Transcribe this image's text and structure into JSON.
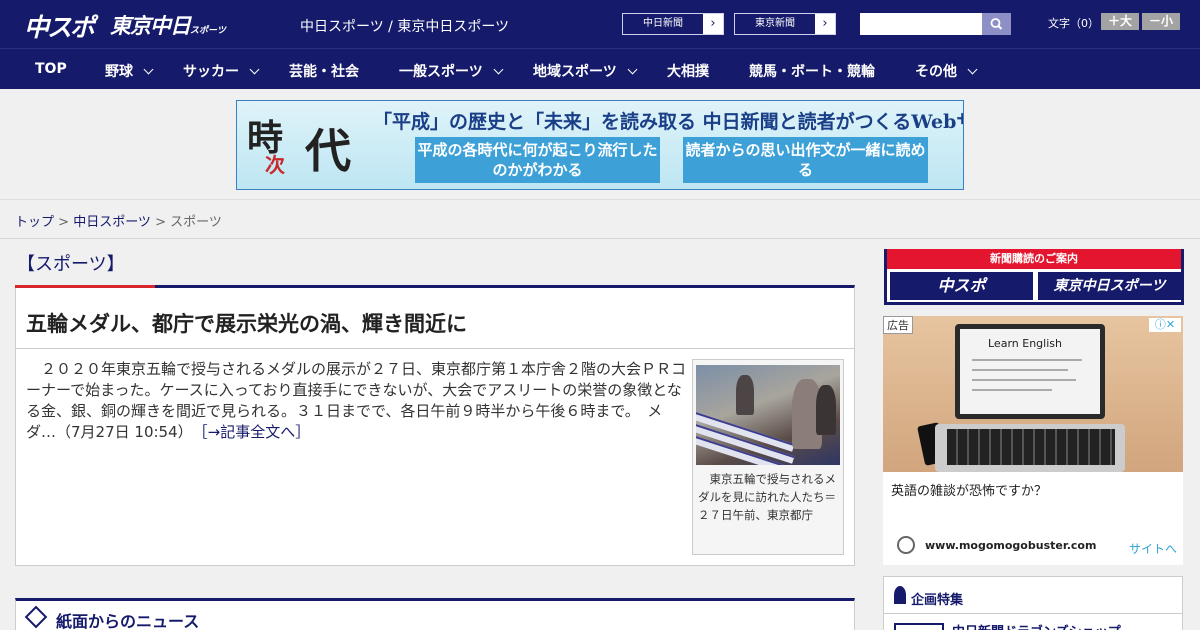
{
  "header": {
    "logo_chuspo": "中スポ",
    "logo_tokyo": "東京中日",
    "logo_tokyo_small": "スポーツ",
    "site_name": "中日スポーツ / 東京中日スポーツ",
    "ext_links": [
      "中日新聞",
      "東京新聞"
    ],
    "search_placeholder": "",
    "font_size_label": "文字（0）",
    "font_bigger": "＋大",
    "font_smaller": "－小"
  },
  "nav": {
    "items": [
      {
        "label": "TOP",
        "has_menu": false
      },
      {
        "label": "野球",
        "has_menu": true
      },
      {
        "label": "サッカー",
        "has_menu": true
      },
      {
        "label": "芸能・社会",
        "has_menu": false
      },
      {
        "label": "一般スポーツ",
        "has_menu": true
      },
      {
        "label": "地域スポーツ",
        "has_menu": true
      },
      {
        "label": "大相撲",
        "has_menu": false
      },
      {
        "label": "競馬・ボート・競輪",
        "has_menu": false
      },
      {
        "label": "その他",
        "has_menu": true
      }
    ]
  },
  "banner": {
    "ji1": "時",
    "ji2": "次",
    "dai": "代",
    "headline": "「平成」の歴史と「未来」を読み取る 中日新聞と読者がつくるWebサイト",
    "box1": "平成の各時代に何が起こり流行したのかがわかる",
    "box2": "読者からの思い出作文が一緒に読める"
  },
  "breadcrumb": {
    "home": "トップ",
    "sep": " > ",
    "parent": "中日スポーツ",
    "current": "スポーツ"
  },
  "section": {
    "title": "【スポーツ】"
  },
  "article": {
    "title": "五輪メダル、都庁で展示栄光の渦、輝き間近に",
    "body": "２０２０年東京五輪で授与されるメダルの展示が２７日、東京都庁第１本庁舎２階の大会ＰＲコーナーで始まった。ケースに入っており直接手にできないが、大会でアスリートの栄誉の象徴となる金、銀、銅の輝きを間近で見られる。３１日までで、各日午前９時半から午後６時まで。　メダ…（7月27日 10:54）",
    "more_link": "［→記事全文へ］",
    "photo_caption": "東京五輪で授与されるメダルを見に訪れた人たち＝２７日午前、東京都庁"
  },
  "news_section": {
    "title": "紙面からのニュース"
  },
  "sidebar": {
    "subscribe_head": "新聞購読のご案内",
    "subscribe_logos": [
      "中スポ",
      "東京中日スポーツ"
    ],
    "ad": {
      "label": "広告",
      "screen_title": "Learn English",
      "text": "英語の雑談が恐怖ですか？",
      "domain": "www.mogomogobuster.com",
      "site_link": "サイトへ"
    },
    "feature": {
      "title": "企画特集",
      "item": "中日新聞ドラゴンズショップ"
    }
  },
  "colors": {
    "navy": "#151a6b",
    "red": "#d8262d",
    "ad_blue": "#2fa4d8"
  }
}
